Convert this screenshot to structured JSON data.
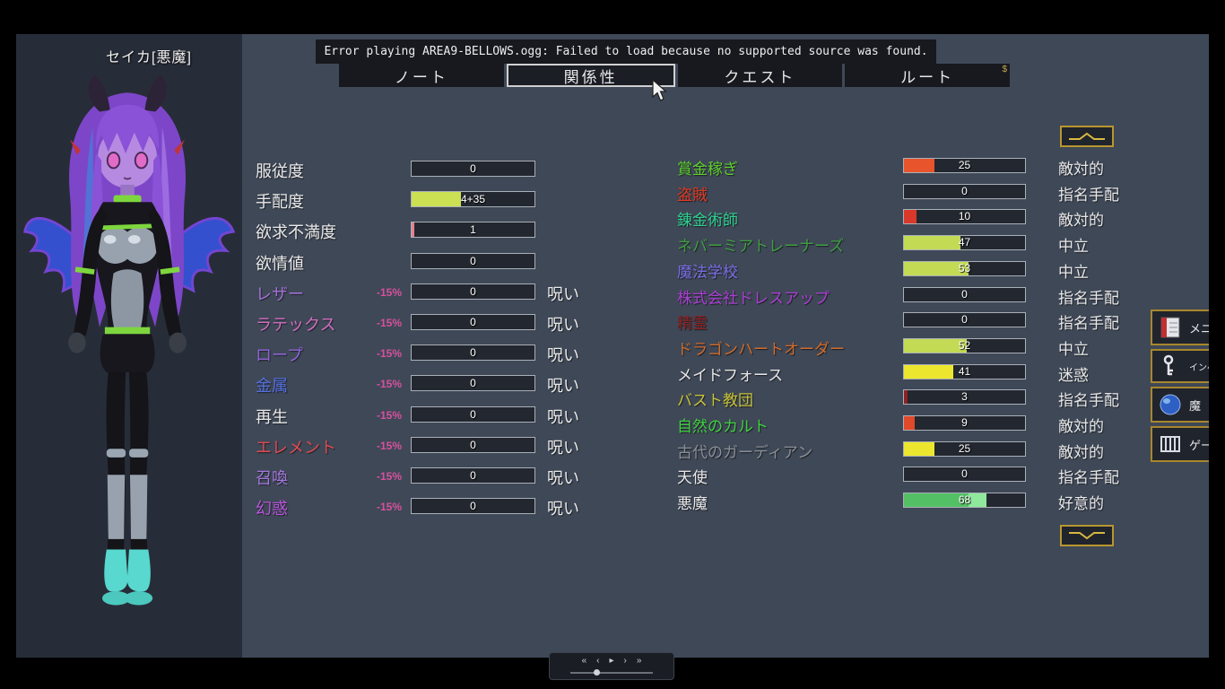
{
  "meta": {
    "character_name": "セイカ[悪魔]"
  },
  "error_toast": {
    "text": "Error playing AREA9-BELLOWS.ogg: Failed to load because no supported source was found."
  },
  "tabs": [
    {
      "label": "ノート"
    },
    {
      "label": "関係性",
      "selected": true
    },
    {
      "label": "クエスト"
    },
    {
      "label": "ルート",
      "corner": "$"
    }
  ],
  "palette": {
    "gold": "#b8962f",
    "curse_mod": "#d6519e",
    "bar_track": "#23272f",
    "bar_border": "#aab0b8"
  },
  "left_stats": {
    "rows": [
      {
        "label": "服従度",
        "value": "0",
        "fill": 0
      },
      {
        "label": "手配度",
        "value": "4+35",
        "fill": 40,
        "fill_color": "#cbe052"
      },
      {
        "label": "欲求不満度",
        "value": "1",
        "fill": 2,
        "fill_color": "#e8808e"
      },
      {
        "label": "欲情値",
        "value": "0",
        "fill": 0
      },
      {
        "label": "レザー",
        "color": "#a271d6",
        "mod": "-15%",
        "value": "0",
        "fill": 0,
        "suffix": "呪い"
      },
      {
        "label": "ラテックス",
        "color": "#d36fc3",
        "mod": "-15%",
        "value": "0",
        "fill": 0,
        "suffix": "呪い"
      },
      {
        "label": "ロープ",
        "color": "#8e64d8",
        "mod": "-15%",
        "value": "0",
        "fill": 0,
        "suffix": "呪い"
      },
      {
        "label": "金属",
        "color": "#5570e0",
        "mod": "-15%",
        "value": "0",
        "fill": 0,
        "suffix": "呪い"
      },
      {
        "label": "再生",
        "mod": "-15%",
        "value": "0",
        "fill": 0,
        "suffix": "呪い"
      },
      {
        "label": "エレメント",
        "color": "#e04a52",
        "mod": "-15%",
        "value": "0",
        "fill": 0,
        "suffix": "呪い"
      },
      {
        "label": "召喚",
        "color": "#a578dd",
        "mod": "-15%",
        "value": "0",
        "fill": 0,
        "suffix": "呪い"
      },
      {
        "label": "幻惑",
        "color": "#bb55dd",
        "mod": "-15%",
        "value": "0",
        "fill": 0,
        "suffix": "呪い"
      }
    ]
  },
  "factions": {
    "rows": [
      {
        "label": "賞金稼ぎ",
        "color": "#5fcf2e",
        "value": "25",
        "fill": 25,
        "fill_color": "#e8542c",
        "status": "敵対的"
      },
      {
        "label": "盗賊",
        "color": "#e03a22",
        "value": "0",
        "fill": 0,
        "status": "指名手配"
      },
      {
        "label": "錬金術師",
        "color": "#2fcf8f",
        "value": "10",
        "fill": 10,
        "fill_color": "#d8392a",
        "status": "敵対的"
      },
      {
        "label": "ネバーミアトレーナーズ",
        "color": "#3f9f42",
        "value": "47",
        "fill": 47,
        "fill_color": "#c3da55",
        "status": "中立"
      },
      {
        "label": "魔法学校",
        "color": "#7a6ee2",
        "value": "53",
        "fill": 53,
        "fill_color": "#c3da55",
        "status": "中立"
      },
      {
        "label": "株式会社ドレスアップ",
        "color": "#ab3fd2",
        "value": "0",
        "fill": 0,
        "status": "指名手配"
      },
      {
        "label": "精霊",
        "color": "#8e2222",
        "value": "0",
        "fill": 0,
        "status": "指名手配"
      },
      {
        "label": "ドラゴンハートオーダー",
        "color": "#cf6c2c",
        "value": "52",
        "fill": 52,
        "fill_color": "#c3da55",
        "status": "中立"
      },
      {
        "label": "メイドフォース",
        "color": "#e8e8e8",
        "value": "41",
        "fill": 41,
        "fill_color": "#ece62e",
        "status": "迷惑"
      },
      {
        "label": "バスト教団",
        "color": "#c9c43a",
        "value": "3",
        "fill": 3,
        "fill_color": "#8e2222",
        "status": "指名手配"
      },
      {
        "label": "自然のカルト",
        "color": "#3fd23f",
        "value": "9",
        "fill": 9,
        "fill_color": "#e0492a",
        "status": "敵対的"
      },
      {
        "label": "古代のガーディアン",
        "color": "#8b9097",
        "value": "25",
        "fill": 25,
        "fill_color": "#ece62e",
        "status": "敵対的"
      },
      {
        "label": "天使",
        "color": "#e8e8e8",
        "value": "0",
        "fill": 0,
        "status": "指名手配"
      },
      {
        "label": "悪魔",
        "color": "#e8e8e8",
        "value": "68",
        "fill": 68,
        "fill_color": "linear-gradient(90deg,#54c065 0 78%,#8fe89b 78% 100%)",
        "status": "好意的"
      }
    ]
  },
  "scroll_buttons": {
    "up": "chevron-up",
    "down": "chevron-down"
  },
  "side_menu": [
    {
      "icon": "notebook-icon",
      "label": "メニ"
    },
    {
      "icon": "key-icon",
      "label": "インベ"
    },
    {
      "icon": "orb-icon",
      "label": "魔"
    },
    {
      "icon": "grid-icon",
      "label": "ゲー"
    }
  ],
  "media": {
    "controls": [
      {
        "name": "skip-back-icon",
        "glyph": "«"
      },
      {
        "name": "rewind-icon",
        "glyph": "‹"
      },
      {
        "name": "play-icon",
        "glyph": "▸"
      },
      {
        "name": "forward-icon",
        "glyph": "›"
      },
      {
        "name": "skip-forward-icon",
        "glyph": "»"
      }
    ]
  }
}
